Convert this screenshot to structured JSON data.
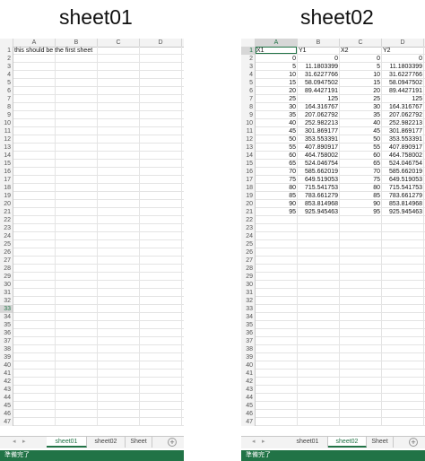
{
  "captions": {
    "left": "sheet01",
    "right": "sheet02"
  },
  "left_workbook": {
    "columns": [
      "A",
      "B",
      "C",
      "D"
    ],
    "row_count": 47,
    "selected_row": 33,
    "a1_text": "this should be the first sheet",
    "tabs": [
      "sheet01",
      "sheet02",
      "Sheet"
    ],
    "active_tab": "sheet01",
    "status": "準備完了"
  },
  "right_workbook": {
    "columns": [
      "A",
      "B",
      "C",
      "D"
    ],
    "row_count": 47,
    "selected_col": "A",
    "selected_row": 1,
    "headers": [
      "X1",
      "Y1",
      "X2",
      "Y2"
    ],
    "data": [
      [
        "0",
        "0",
        "0",
        "0"
      ],
      [
        "5",
        "11.1803399",
        "5",
        "11.1803399"
      ],
      [
        "10",
        "31.6227766",
        "10",
        "31.6227766"
      ],
      [
        "15",
        "58.0947502",
        "15",
        "58.0947502"
      ],
      [
        "20",
        "89.4427191",
        "20",
        "89.4427191"
      ],
      [
        "25",
        "125",
        "25",
        "125"
      ],
      [
        "30",
        "164.316767",
        "30",
        "164.316767"
      ],
      [
        "35",
        "207.062792",
        "35",
        "207.062792"
      ],
      [
        "40",
        "252.982213",
        "40",
        "252.982213"
      ],
      [
        "45",
        "301.869177",
        "45",
        "301.869177"
      ],
      [
        "50",
        "353.553391",
        "50",
        "353.553391"
      ],
      [
        "55",
        "407.890917",
        "55",
        "407.890917"
      ],
      [
        "60",
        "464.758002",
        "60",
        "464.758002"
      ],
      [
        "65",
        "524.046754",
        "65",
        "524.046754"
      ],
      [
        "70",
        "585.662019",
        "70",
        "585.662019"
      ],
      [
        "75",
        "649.519053",
        "75",
        "649.519053"
      ],
      [
        "80",
        "715.541753",
        "80",
        "715.541753"
      ],
      [
        "85",
        "783.661279",
        "85",
        "783.661279"
      ],
      [
        "90",
        "853.814968",
        "90",
        "853.814968"
      ],
      [
        "95",
        "925.945463",
        "95",
        "925.945463"
      ]
    ],
    "tabs": [
      "sheet01",
      "sheet02",
      "Sheet"
    ],
    "active_tab": "sheet02",
    "status": "準備完了"
  },
  "icons": {
    "nav_prev": "◂",
    "nav_next": "▸",
    "add_sheet": "+"
  },
  "colors": {
    "accent": "#217346"
  }
}
